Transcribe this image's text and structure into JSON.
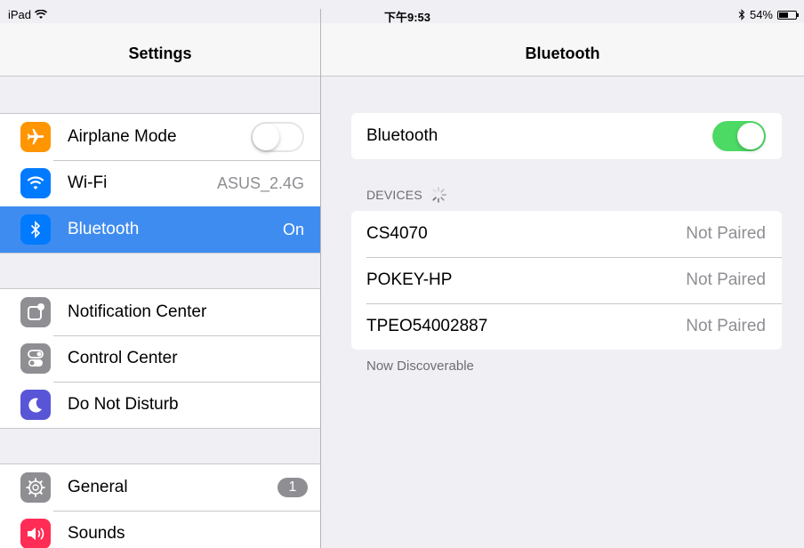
{
  "status": {
    "device": "iPad",
    "time": "下午9:53",
    "battery": "54%",
    "battery_level": 0.54
  },
  "left": {
    "title": "Settings",
    "group1": [
      {
        "label": "Airplane Mode",
        "icon": "airplane-icon",
        "color": "#ff9500",
        "control": "toggle-off"
      },
      {
        "label": "Wi-Fi",
        "value": "ASUS_2.4G",
        "icon": "wifi-icon",
        "color": "#007aff"
      },
      {
        "label": "Bluetooth",
        "value": "On",
        "icon": "bluetooth-icon",
        "color": "#007aff",
        "selected": true
      }
    ],
    "group2": [
      {
        "label": "Notification Center",
        "icon": "notification-center-icon",
        "color": "#8e8e93"
      },
      {
        "label": "Control Center",
        "icon": "control-center-icon",
        "color": "#8e8e93"
      },
      {
        "label": "Do Not Disturb",
        "icon": "moon-icon",
        "color": "#5856d6"
      }
    ],
    "group3": [
      {
        "label": "General",
        "badge": "1",
        "icon": "gear-icon",
        "color": "#8e8e93"
      },
      {
        "label": "Sounds",
        "icon": "speaker-icon",
        "color": "#ff2d55"
      }
    ]
  },
  "right": {
    "title": "Bluetooth",
    "bluetooth_label": "Bluetooth",
    "devices_header": "DEVICES",
    "devices": [
      {
        "name": "CS4070",
        "status": "Not Paired"
      },
      {
        "name": "POKEY-HP",
        "status": "Not Paired"
      },
      {
        "name": "TPEO54002887",
        "status": "Not Paired"
      }
    ],
    "footer": "Now Discoverable"
  },
  "colors": {
    "selection": "#3f8cf0",
    "toggle_on": "#4cd964"
  }
}
